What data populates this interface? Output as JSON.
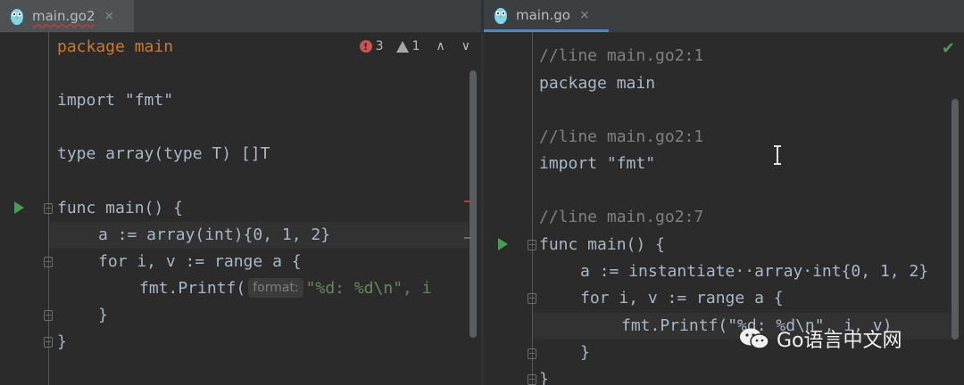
{
  "left_pane": {
    "tab": {
      "label": "main.go2",
      "close": "×"
    },
    "inspections": {
      "errors": "3",
      "warnings": "1",
      "up": "∧",
      "down": "∨"
    },
    "code_lines": [
      "package main",
      "import \"fmt\"",
      "type array(type T) []T",
      "func main() {",
      "a := array(int){0, 1, 2}",
      "for i, v := range a {",
      "fmt.Printf(",
      "}",
      "}"
    ],
    "param_hint": "format:",
    "printf_args": "\"%d: %d\\n\", i"
  },
  "right_pane": {
    "tab": {
      "label": "main.go",
      "close": "×"
    },
    "code_lines": [
      "//line main.go2:1",
      "package main",
      "//line main.go2:1",
      "import \"fmt\"",
      "//line main.go2:7",
      "func main() {",
      "a := instantiate··array·int{0, 1, 2}",
      "for i, v := range a {",
      "fmt.Printf(\"%d: %d\\n\", i, v)",
      "}",
      "}"
    ]
  },
  "watermark": {
    "text": "Go语言中文网"
  },
  "colors": {
    "background": "#2b2b2b",
    "keyword": "#cc7832",
    "function": "#ffc66d",
    "string": "#6a8759",
    "number": "#6897bb",
    "comment": "#808080",
    "run_icon": "#499c54",
    "error": "#c75450"
  },
  "icons": [
    "gopher-icon",
    "close-icon",
    "error-icon",
    "warning-icon",
    "chevron-up-icon",
    "chevron-down-icon",
    "run-icon",
    "fold-icon",
    "checkmark-icon",
    "text-cursor-icon",
    "wechat-icon"
  ]
}
